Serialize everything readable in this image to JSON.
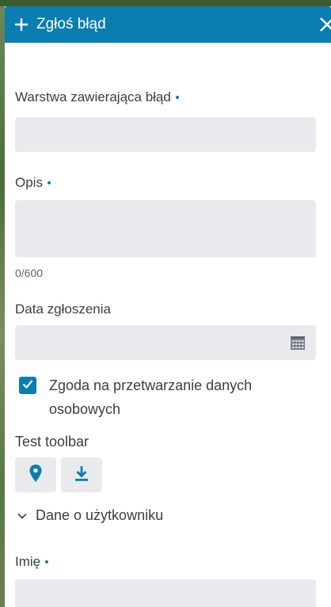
{
  "panel": {
    "title": "Zgłoś błąd",
    "accent": "#0a7db1"
  },
  "form": {
    "layer": {
      "label": "Warstwa zawierająca błąd",
      "value": ""
    },
    "description": {
      "label": "Opis",
      "value": "",
      "counter": "0/600"
    },
    "date": {
      "label": "Data zgłoszenia",
      "value": "",
      "icon": "calendar-icon"
    },
    "consent": {
      "label_line1": "Zgoda na przetwarzanie danych",
      "label_line2": "osobowych",
      "checked": true
    },
    "toolbar": {
      "label": "Test toolbar",
      "buttons": [
        "location-pin-icon",
        "download-icon"
      ]
    },
    "user_section": {
      "label": "Dane o użytkowniku",
      "expanded": true
    },
    "first_name": {
      "label": "Imię",
      "value": ""
    }
  }
}
